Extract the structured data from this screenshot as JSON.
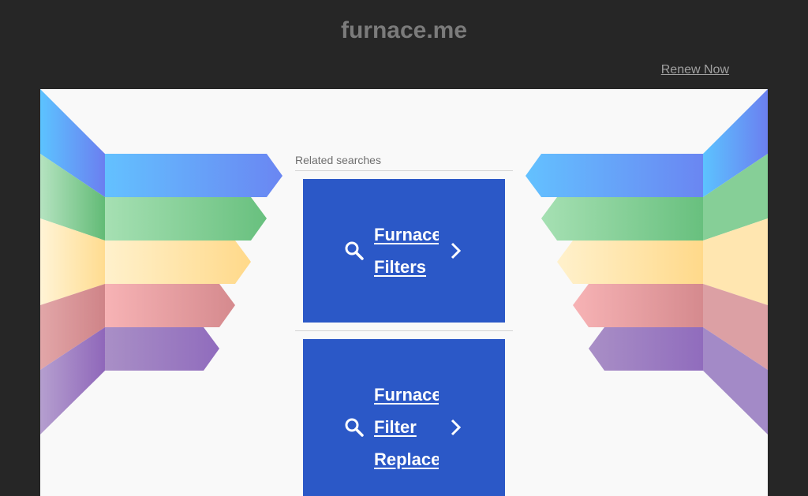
{
  "header": {
    "domain": "furnace.me",
    "renew_link": "Renew Now"
  },
  "related": {
    "heading": "Related searches",
    "cards": [
      {
        "lines": [
          "Furnace",
          "Filters"
        ]
      },
      {
        "lines": [
          "Furnace",
          "Filter",
          "Replacement"
        ]
      }
    ]
  },
  "colors": {
    "page_background": "#262626",
    "panel_background": "#f9f9f9",
    "card_background": "#2b58c7",
    "stripe_blue": "#6a9cf5",
    "stripe_green": "#7ccc8b",
    "stripe_yellow": "#ffe3a6",
    "stripe_red": "#eaa3a6",
    "stripe_purple": "#a98cc8"
  },
  "icons": {
    "card_search": "search-icon",
    "card_arrow": "chevron-right-icon"
  }
}
